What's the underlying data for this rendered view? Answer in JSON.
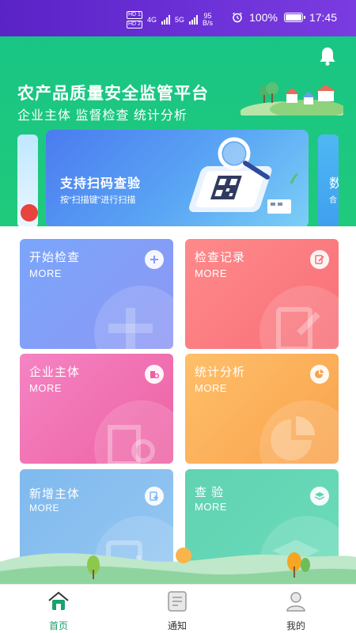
{
  "status_bar": {
    "hd1": "HD 1",
    "hd2": "HD 2",
    "net1": "4G",
    "net2": "5G",
    "speed_value": "95",
    "speed_unit": "B/s",
    "battery": "100%",
    "time": "17:45",
    "battery_level": 1.0
  },
  "hero": {
    "title": "农产品质量安全监管平台",
    "subtitle": "企业主体 监督检查 统计分析"
  },
  "banner": {
    "title": "支持扫码查验",
    "subtitle": "按“扫描键”进行扫描",
    "right_peek_title": "数",
    "right_peek_sub": "合"
  },
  "cards": [
    {
      "title": "开始检查",
      "more": "MORE",
      "icon": "plus-icon"
    },
    {
      "title": "检查记录",
      "more": "MORE",
      "icon": "edit-record-icon"
    },
    {
      "title": "企业主体",
      "more": "MORE",
      "icon": "building-search-icon"
    },
    {
      "title": "统计分析",
      "more": "MORE",
      "icon": "pie-chart-icon"
    },
    {
      "title": "新增主体",
      "more": "MORE",
      "icon": "add-entity-icon"
    },
    {
      "title": "查  验",
      "more": "MORE",
      "icon": "layers-icon"
    }
  ],
  "tabbar": {
    "home": "首页",
    "notice": "通知",
    "mine": "我的",
    "active_color": "#1aa26c"
  },
  "colors": {
    "status_bar": "#6d32d8",
    "hero": "#1fca7c"
  }
}
